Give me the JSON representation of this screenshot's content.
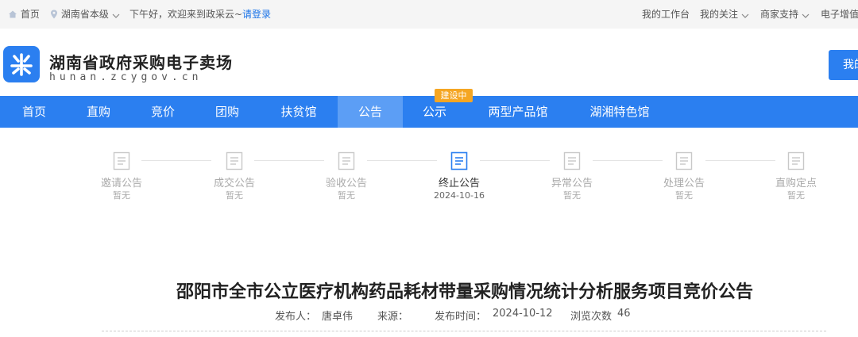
{
  "topbar": {
    "home": "首页",
    "region": "湖南省本级",
    "greeting": "下午好，欢迎来到政采云~",
    "login": "请登录",
    "workbench": "我的工作台",
    "my_follow": "我的关注",
    "merchant_support": "商家支持",
    "e_invoice": "电子增值"
  },
  "header": {
    "title": "湖南省政府采购电子卖场",
    "domain": "hunan.zcygov.cn",
    "button_label": "我的"
  },
  "nav": {
    "items": [
      "首页",
      "直购",
      "竞价",
      "团购",
      "扶贫馆",
      "公告",
      "公示",
      "两型产品馆",
      "湖湘特色馆"
    ],
    "active_index": 5,
    "badge": "建设中"
  },
  "steps": {
    "items": [
      {
        "name": "邀请公告",
        "status": "暂无"
      },
      {
        "name": "成交公告",
        "status": "暂无"
      },
      {
        "name": "验收公告",
        "status": "暂无"
      },
      {
        "name": "终止公告",
        "status": "2024-10-16"
      },
      {
        "name": "异常公告",
        "status": "暂无"
      },
      {
        "name": "处理公告",
        "status": "暂无"
      },
      {
        "name": "直购定点",
        "status": "暂无"
      }
    ],
    "current_index": 3
  },
  "article": {
    "title": "邵阳市全市公立医疗机构药品耗材带量采购情况统计分析服务项目竞价公告",
    "publisher_label": "发布人：",
    "publisher": "唐卓伟",
    "source_label": "来源：",
    "source": "",
    "publish_time_label": "发布时间：",
    "publish_time": "2024-10-12",
    "views_label": "浏览次数",
    "views": "46"
  },
  "colors": {
    "primary": "#2b7ff0",
    "nav_active": "#5c9ef5",
    "badge": "#f5a623",
    "topbar_bg": "#f5f5f5",
    "login_link": "#1a73e8"
  }
}
